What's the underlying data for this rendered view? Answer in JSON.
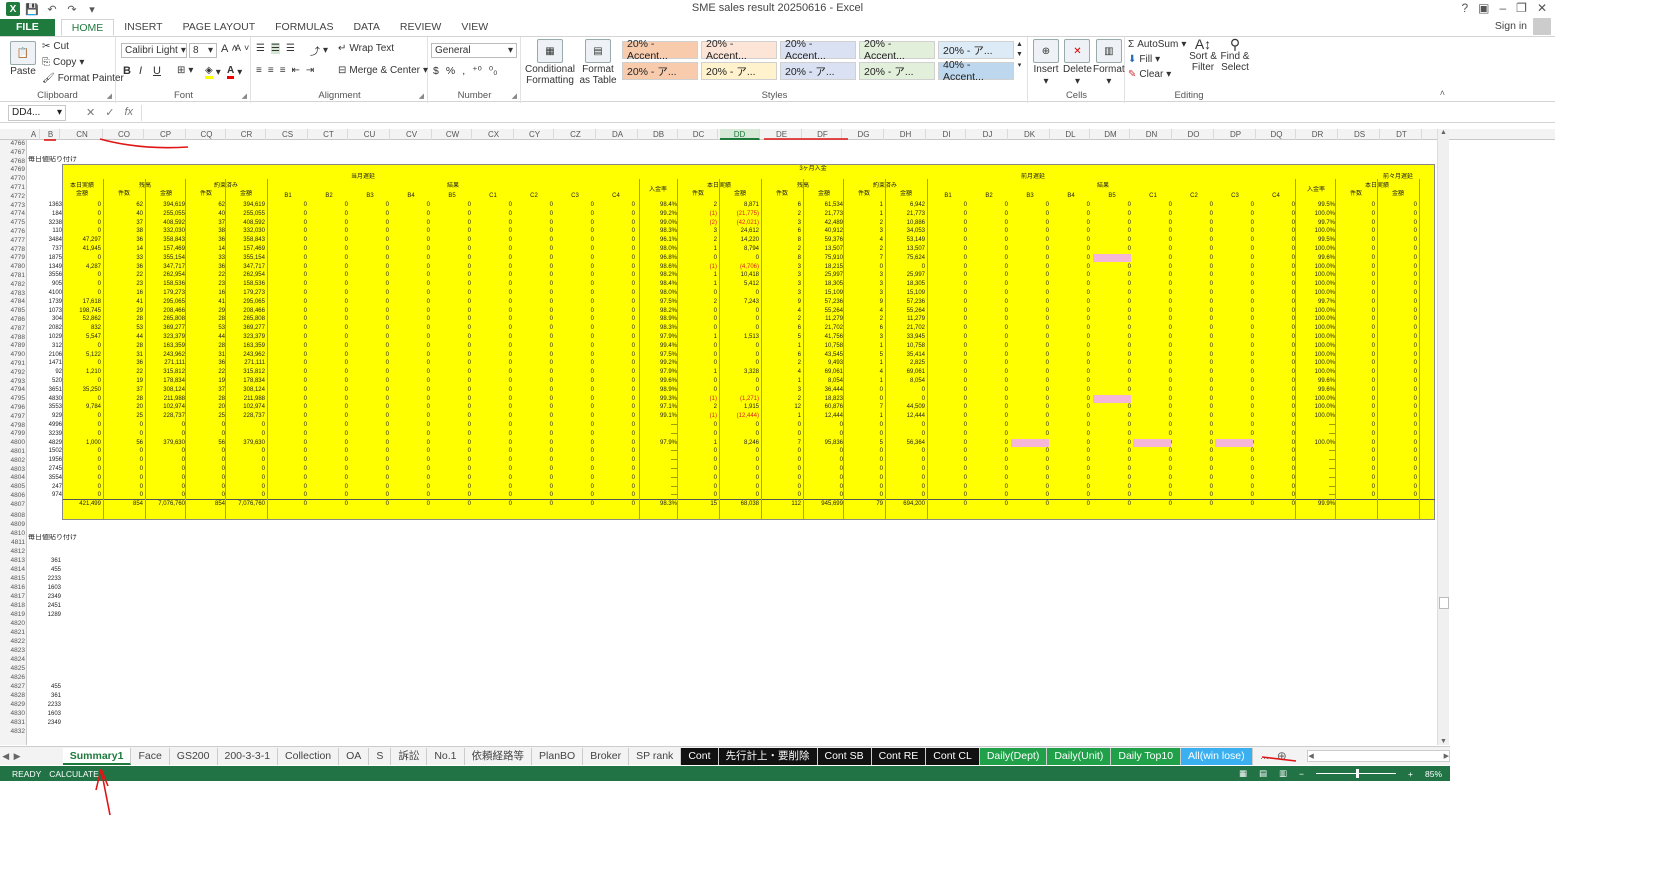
{
  "window": {
    "doc_title": "SME sales result 20250616 - Excel",
    "signin": "Sign in"
  },
  "ribbon_tabs": [
    "FILE",
    "HOME",
    "INSERT",
    "PAGE LAYOUT",
    "FORMULAS",
    "DATA",
    "REVIEW",
    "VIEW"
  ],
  "clipboard": {
    "paste": "Paste",
    "cut": "Cut",
    "copy": "Copy",
    "format_painter": "Format Painter",
    "label": "Clipboard"
  },
  "font": {
    "family": "Calibri Light",
    "size": "8",
    "label": "Font",
    "bold": "B",
    "italic": "I",
    "underline": "U",
    "a": "A"
  },
  "alignment": {
    "wrap": "Wrap Text",
    "merge": "Merge & Center",
    "label": "Alignment"
  },
  "number": {
    "format": "General",
    "dollar": "$",
    "percent": "%",
    "comma": ",",
    "label": "Number"
  },
  "styles_grp": {
    "conditional": "Conditional Formatting",
    "format_table": "Format as Table",
    "label": "Styles",
    "cells": [
      {
        "text": "20% - Accent...",
        "bg": "#f8cbad"
      },
      {
        "text": "20% - Accent...",
        "bg": "#fce4d6"
      },
      {
        "text": "20% - Accent...",
        "bg": "#d9e1f2"
      },
      {
        "text": "20% - Accent...",
        "bg": "#e2efda"
      },
      {
        "text": "20% - ア...",
        "bg": "#ddebf7"
      },
      {
        "text": "20% - ア...",
        "bg": "#f8cbad"
      },
      {
        "text": "20% - ア...",
        "bg": "#fff2cc"
      },
      {
        "text": "20% - ア...",
        "bg": "#d9e1f2"
      },
      {
        "text": "20% - ア...",
        "bg": "#e2efda"
      },
      {
        "text": "40% - Accent...",
        "bg": "#bdd7ee"
      }
    ]
  },
  "cells_grp": {
    "insert": "Insert",
    "delete": "Delete",
    "format": "Format",
    "label": "Cells"
  },
  "editing": {
    "autosum": "AutoSum",
    "fill": "Fill",
    "clear": "Clear",
    "sort": "Sort & Filter",
    "find": "Find & Select",
    "label": "Editing"
  },
  "formula_bar": {
    "namebox": "DD4...",
    "fx": "fx",
    "x": "✕",
    "check": "✓"
  },
  "columns": [
    "A",
    "B",
    "CN",
    "CO",
    "CP",
    "CQ",
    "CR",
    "CS",
    "CT",
    "CU",
    "CV",
    "CW",
    "CX",
    "CY",
    "CZ",
    "DA",
    "DB",
    "DC",
    "DD",
    "DE",
    "DF",
    "DG",
    "DH",
    "DI",
    "DJ",
    "DK",
    "DL",
    "DM",
    "DN",
    "DO",
    "DP",
    "DQ",
    "DR",
    "DS",
    "DT"
  ],
  "rows_upper": [
    "4766",
    "4767",
    "4768",
    "4769",
    "4770",
    "4771",
    "4772",
    "4773",
    "4774",
    "4775",
    "4776",
    "4777",
    "4778",
    "4779",
    "4780",
    "4781",
    "4782",
    "4783",
    "4784",
    "4785",
    "4786",
    "4787",
    "4788",
    "4789",
    "4790",
    "4791",
    "4792",
    "4793",
    "4794",
    "4795",
    "4796",
    "4797",
    "4798",
    "4799",
    "4800",
    "4801",
    "4802",
    "4803",
    "4804",
    "4805",
    "4806",
    "4807"
  ],
  "rows_lower": [
    "4808",
    "4809",
    "4810",
    "4811",
    "4812",
    "4813",
    "4814",
    "4815",
    "4816",
    "4817",
    "4818",
    "4819",
    "4820",
    "4821",
    "4822",
    "4823",
    "4824",
    "4825",
    "4826",
    "4827",
    "4828",
    "4829",
    "4830",
    "4831",
    "4832"
  ],
  "sheet_labels": {
    "daily_paste_1": "毎日値貼り付け",
    "daily_paste_2": "毎日値貼り付け"
  },
  "table_headers": {
    "top_mid": "3ヶ月入金",
    "current": "当月遅延",
    "prev": "前月遅延",
    "prev2": "前々月遅延",
    "today": "本日実績",
    "balance": "残高",
    "promised": "約束済み",
    "result": "結果",
    "rate": "入金率",
    "amount": "金額",
    "count": "件数",
    "result_cols": [
      "B1",
      "B2",
      "B3",
      "B4",
      "B5",
      "C1",
      "C2",
      "C3",
      "C4"
    ]
  },
  "col_b_upper": [
    "1363",
    "184",
    "3238",
    "110",
    "3484",
    "737",
    "1875",
    "1349",
    "3556",
    "905",
    "4100",
    "1739",
    "1073",
    "304",
    "2082",
    "1029",
    "312",
    "2106",
    "1471",
    "92",
    "520",
    "3651",
    "4830",
    "3553",
    "929",
    "4996",
    "3239",
    "4829",
    "1502",
    "1956",
    "2745",
    "3554",
    "247",
    "974"
  ],
  "rows_data": [
    {
      "cn": "0",
      "co": "62",
      "cp": "394,619",
      "cq": "62",
      "cr": "394,619",
      "rate": "98.4%",
      "dc": "2",
      "dd": "8,871",
      "de": "6",
      "df": "61,534",
      "dg": "1",
      "dh": "6,942",
      "rate2": "99.5%"
    },
    {
      "cn": "0",
      "co": "40",
      "cp": "255,055",
      "cq": "40",
      "cr": "255,055",
      "rate": "99.2%",
      "dc": "(1)",
      "dd": "(21,775)",
      "de": "2",
      "df": "21,773",
      "dg": "1",
      "dh": "21,773",
      "rate2": "100.0%"
    },
    {
      "cn": "0",
      "co": "37",
      "cp": "408,592",
      "cq": "37",
      "cr": "408,592",
      "rate": "99.0%",
      "dc": "(2)",
      "dd": "(42,021)",
      "de": "3",
      "df": "42,489",
      "dg": "2",
      "dh": "10,886",
      "rate2": "99.7%"
    },
    {
      "cn": "0",
      "co": "38",
      "cp": "332,030",
      "cq": "38",
      "cr": "332,030",
      "rate": "98.3%",
      "dc": "3",
      "dd": "24,612",
      "de": "6",
      "df": "40,912",
      "dg": "3",
      "dh": "34,053",
      "rate2": "100.0%"
    },
    {
      "cn": "47,297",
      "co": "36",
      "cp": "358,843",
      "cq": "36",
      "cr": "358,843",
      "rate": "96.1%",
      "dc": "2",
      "dd": "14,220",
      "de": "8",
      "df": "59,376",
      "dg": "4",
      "dh": "53,149",
      "rate2": "99.5%"
    },
    {
      "cn": "41,945",
      "co": "14",
      "cp": "157,469",
      "cq": "14",
      "cr": "157,469",
      "rate": "98.0%",
      "dc": "1",
      "dd": "8,794",
      "de": "2",
      "df": "13,507",
      "dg": "2",
      "dh": "13,507",
      "rate2": "100.0%"
    },
    {
      "cn": "0",
      "co": "33",
      "cp": "355,154",
      "cq": "33",
      "cr": "355,154",
      "rate": "96.8%",
      "dc": "0",
      "dd": "0",
      "de": "8",
      "df": "75,910",
      "dg": "7",
      "dh": "75,624",
      "rate2": "99.6%"
    },
    {
      "cn": "4,287",
      "co": "36",
      "cp": "347,717",
      "cq": "36",
      "cr": "347,717",
      "rate": "98.6%",
      "dc": "(1)",
      "dd": "(4,706)",
      "de": "3",
      "df": "18,215",
      "dg": "0",
      "dh": "0",
      "rate2": "100.0%"
    },
    {
      "cn": "0",
      "co": "22",
      "cp": "262,954",
      "cq": "22",
      "cr": "262,954",
      "rate": "98.2%",
      "dc": "1",
      "dd": "10,418",
      "de": "3",
      "df": "25,997",
      "dg": "3",
      "dh": "25,997",
      "rate2": "100.0%"
    },
    {
      "cn": "0",
      "co": "23",
      "cp": "158,536",
      "cq": "23",
      "cr": "158,536",
      "rate": "98.4%",
      "dc": "1",
      "dd": "5,412",
      "de": "3",
      "df": "18,305",
      "dg": "3",
      "dh": "18,305",
      "rate2": "100.0%"
    },
    {
      "cn": "0",
      "co": "16",
      "cp": "179,273",
      "cq": "16",
      "cr": "179,273",
      "rate": "98.0%",
      "dc": "0",
      "dd": "0",
      "de": "3",
      "df": "15,109",
      "dg": "3",
      "dh": "15,109",
      "rate2": "100.0%"
    },
    {
      "cn": "17,618",
      "co": "41",
      "cp": "295,065",
      "cq": "41",
      "cr": "295,065",
      "rate": "97.5%",
      "dc": "2",
      "dd": "7,243",
      "de": "9",
      "df": "57,236",
      "dg": "9",
      "dh": "57,236",
      "rate2": "99.7%"
    },
    {
      "cn": "198,745",
      "co": "29",
      "cp": "208,466",
      "cq": "29",
      "cr": "208,466",
      "rate": "98.2%",
      "dc": "0",
      "dd": "0",
      "de": "4",
      "df": "55,264",
      "dg": "4",
      "dh": "55,264",
      "rate2": "100.0%"
    },
    {
      "cn": "52,862",
      "co": "28",
      "cp": "265,808",
      "cq": "28",
      "cr": "265,808",
      "rate": "98.9%",
      "dc": "0",
      "dd": "0",
      "de": "2",
      "df": "11,279",
      "dg": "2",
      "dh": "11,279",
      "rate2": "100.0%"
    },
    {
      "cn": "832",
      "co": "53",
      "cp": "369,277",
      "cq": "53",
      "cr": "369,277",
      "rate": "98.3%",
      "dc": "0",
      "dd": "0",
      "de": "6",
      "df": "21,702",
      "dg": "6",
      "dh": "21,702",
      "rate2": "100.0%"
    },
    {
      "cn": "5,547",
      "co": "44",
      "cp": "323,379",
      "cq": "44",
      "cr": "323,379",
      "rate": "97.9%",
      "dc": "1",
      "dd": "1,513",
      "de": "5",
      "df": "41,756",
      "dg": "3",
      "dh": "33,945",
      "rate2": "100.0%"
    },
    {
      "cn": "0",
      "co": "28",
      "cp": "163,359",
      "cq": "28",
      "cr": "163,359",
      "rate": "99.4%",
      "dc": "0",
      "dd": "0",
      "de": "1",
      "df": "10,758",
      "dg": "1",
      "dh": "10,758",
      "rate2": "100.0%"
    },
    {
      "cn": "5,122",
      "co": "31",
      "cp": "243,962",
      "cq": "31",
      "cr": "243,962",
      "rate": "97.5%",
      "dc": "0",
      "dd": "0",
      "de": "6",
      "df": "43,545",
      "dg": "5",
      "dh": "35,414",
      "rate2": "100.0%"
    },
    {
      "cn": "0",
      "co": "36",
      "cp": "271,111",
      "cq": "36",
      "cr": "271,111",
      "rate": "99.2%",
      "dc": "0",
      "dd": "0",
      "de": "2",
      "df": "9,493",
      "dg": "1",
      "dh": "2,825",
      "rate2": "100.0%"
    },
    {
      "cn": "1,210",
      "co": "22",
      "cp": "315,812",
      "cq": "22",
      "cr": "315,812",
      "rate": "97.9%",
      "dc": "1",
      "dd": "3,328",
      "de": "4",
      "df": "69,061",
      "dg": "4",
      "dh": "69,061",
      "rate2": "100.0%"
    },
    {
      "cn": "0",
      "co": "19",
      "cp": "178,834",
      "cq": "19",
      "cr": "178,834",
      "rate": "99.6%",
      "dc": "0",
      "dd": "0",
      "de": "1",
      "df": "8,054",
      "dg": "1",
      "dh": "8,054",
      "rate2": "99.6%"
    },
    {
      "cn": "35,250",
      "co": "37",
      "cp": "308,124",
      "cq": "37",
      "cr": "308,124",
      "rate": "98.9%",
      "dc": "0",
      "dd": "0",
      "de": "3",
      "df": "36,444",
      "dg": "0",
      "dh": "0",
      "rate2": "99.6%"
    },
    {
      "cn": "0",
      "co": "28",
      "cp": "211,988",
      "cq": "28",
      "cr": "211,988",
      "rate": "99.3%",
      "dc": "(1)",
      "dd": "(1,271)",
      "de": "2",
      "df": "18,823",
      "dg": "0",
      "dh": "0",
      "rate2": "100.0%"
    },
    {
      "cn": "9,784",
      "co": "20",
      "cp": "102,974",
      "cq": "20",
      "cr": "102,974",
      "rate": "97.1%",
      "dc": "2",
      "dd": "1,915",
      "de": "12",
      "df": "60,876",
      "dg": "7",
      "dh": "44,509",
      "rate2": "100.0%"
    },
    {
      "cn": "0",
      "co": "25",
      "cp": "228,737",
      "cq": "25",
      "cr": "228,737",
      "rate": "99.1%",
      "dc": "(1)",
      "dd": "(12,444)",
      "de": "1",
      "df": "12,444",
      "dg": "1",
      "dh": "12,444",
      "rate2": "100.0%"
    },
    {
      "cn": "0",
      "co": "0",
      "cp": "0",
      "cq": "0",
      "cr": "0",
      "rate": "—",
      "dc": "0",
      "dd": "0",
      "de": "0",
      "df": "0",
      "dg": "0",
      "dh": "0",
      "rate2": "—"
    },
    {
      "cn": "0",
      "co": "0",
      "cp": "0",
      "cq": "0",
      "cr": "0",
      "rate": "—",
      "dc": "0",
      "dd": "0",
      "de": "0",
      "df": "0",
      "dg": "0",
      "dh": "0",
      "rate2": "—"
    },
    {
      "cn": "1,000",
      "co": "56",
      "cp": "379,630",
      "cq": "56",
      "cr": "379,630",
      "rate": "97.9%",
      "dc": "1",
      "dd": "8,246",
      "de": "7",
      "df": "95,836",
      "dg": "5",
      "dh": "56,364",
      "rate2": "100.0%"
    },
    {
      "cn": "0",
      "co": "0",
      "cp": "0",
      "cq": "0",
      "cr": "0",
      "rate": "—",
      "dc": "0",
      "dd": "0",
      "de": "0",
      "df": "0",
      "dg": "0",
      "dh": "0",
      "rate2": "—"
    },
    {
      "cn": "0",
      "co": "0",
      "cp": "0",
      "cq": "0",
      "cr": "0",
      "rate": "—",
      "dc": "0",
      "dd": "0",
      "de": "0",
      "df": "0",
      "dg": "0",
      "dh": "0",
      "rate2": "—"
    },
    {
      "cn": "0",
      "co": "0",
      "cp": "0",
      "cq": "0",
      "cr": "0",
      "rate": "—",
      "dc": "0",
      "dd": "0",
      "de": "0",
      "df": "0",
      "dg": "0",
      "dh": "0",
      "rate2": "—"
    },
    {
      "cn": "0",
      "co": "0",
      "cp": "0",
      "cq": "0",
      "cr": "0",
      "rate": "—",
      "dc": "0",
      "dd": "0",
      "de": "0",
      "df": "0",
      "dg": "0",
      "dh": "0",
      "rate2": "—"
    },
    {
      "cn": "0",
      "co": "0",
      "cp": "0",
      "cq": "0",
      "cr": "0",
      "rate": "—",
      "dc": "0",
      "dd": "0",
      "de": "0",
      "df": "0",
      "dg": "0",
      "dh": "0",
      "rate2": "—"
    },
    {
      "cn": "0",
      "co": "0",
      "cp": "0",
      "cq": "0",
      "cr": "0",
      "rate": "—",
      "dc": "0",
      "dd": "0",
      "de": "0",
      "df": "0",
      "dg": "0",
      "dh": "0",
      "rate2": "—"
    }
  ],
  "totals": {
    "cn": "421,499",
    "co": "854",
    "cp": "7,076,760",
    "cq": "854",
    "cr": "7,076,760",
    "rate": "98.3%",
    "dc": "15",
    "dd": "68,038",
    "de": "112",
    "df": "945,699",
    "dg": "79",
    "dh": "694,200",
    "rate2": "99.9%"
  },
  "lower_values": [
    {
      "row": 5,
      "v": "361"
    },
    {
      "row": 6,
      "v": "455"
    },
    {
      "row": 7,
      "v": "2233"
    },
    {
      "row": 8,
      "v": "1603"
    },
    {
      "row": 9,
      "v": "2349"
    },
    {
      "row": 10,
      "v": "2451"
    },
    {
      "row": 11,
      "v": "1289"
    },
    {
      "row": 19,
      "v": "455"
    },
    {
      "row": 20,
      "v": "361"
    },
    {
      "row": 21,
      "v": "2233"
    },
    {
      "row": 22,
      "v": "1603"
    },
    {
      "row": 23,
      "v": "2349"
    }
  ],
  "sheet_tabs": [
    {
      "label": "Summary1",
      "style": "active"
    },
    {
      "label": "Face",
      "style": "normal"
    },
    {
      "label": "GS200",
      "style": "normal"
    },
    {
      "label": "200-3-3-1",
      "style": "normal"
    },
    {
      "label": "Collection",
      "style": "normal"
    },
    {
      "label": "OA",
      "style": "normal"
    },
    {
      "label": "S",
      "style": "normal"
    },
    {
      "label": "訴訟",
      "style": "normal"
    },
    {
      "label": "No.1",
      "style": "normal"
    },
    {
      "label": "依頼経路等",
      "style": "normal"
    },
    {
      "label": "PlanBO",
      "style": "normal"
    },
    {
      "label": "Broker",
      "style": "normal"
    },
    {
      "label": "SP rank",
      "style": "normal"
    },
    {
      "label": "Cont",
      "style": "black"
    },
    {
      "label": "先行計上・要削除",
      "style": "black"
    },
    {
      "label": "Cont SB",
      "style": "black"
    },
    {
      "label": "Cont RE",
      "style": "black"
    },
    {
      "label": "Cont CL",
      "style": "black"
    },
    {
      "label": "Daily(Dept)",
      "style": "green"
    },
    {
      "label": "Daily(Unit)",
      "style": "green"
    },
    {
      "label": "Daily Top10",
      "style": "green"
    },
    {
      "label": "All(win lose)",
      "style": "blue"
    }
  ],
  "status": {
    "ready": "READY",
    "calculate": "CALCULATE",
    "zoom": "85%"
  }
}
